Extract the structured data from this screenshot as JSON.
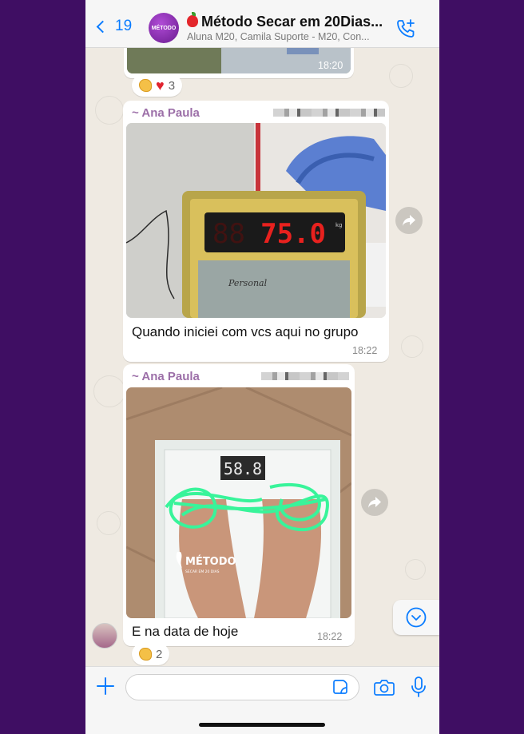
{
  "header": {
    "back_count": "19",
    "avatar_text": "MÉTODO",
    "title": "Método Secar em 20Dias...",
    "participants": "Aluna M20, Camila Suporte - M20, Con..."
  },
  "messages": [
    {
      "time": "18:20",
      "reaction": {
        "count": "3"
      }
    },
    {
      "sender": "~ Ana Paula",
      "caption": "Quando iniciei com vcs aqui no grupo",
      "time": "18:22",
      "photo": {
        "scale_reading": "75.0",
        "unit": "kg",
        "brand": "Personal"
      }
    },
    {
      "sender": "~ Ana Paula",
      "caption": "E  na data de hoje",
      "time": "18:22",
      "photo": {
        "scale_reading": "58.8",
        "watermark": "MÉTODO",
        "watermark_sub": "SECAR EM 20 DIAS"
      },
      "reaction": {
        "count": "2"
      }
    }
  ],
  "colors": {
    "accent": "#0a7cff",
    "sender": "#9c6fa8",
    "background": "#3f0e63",
    "chat_bg": "#efeae2"
  }
}
